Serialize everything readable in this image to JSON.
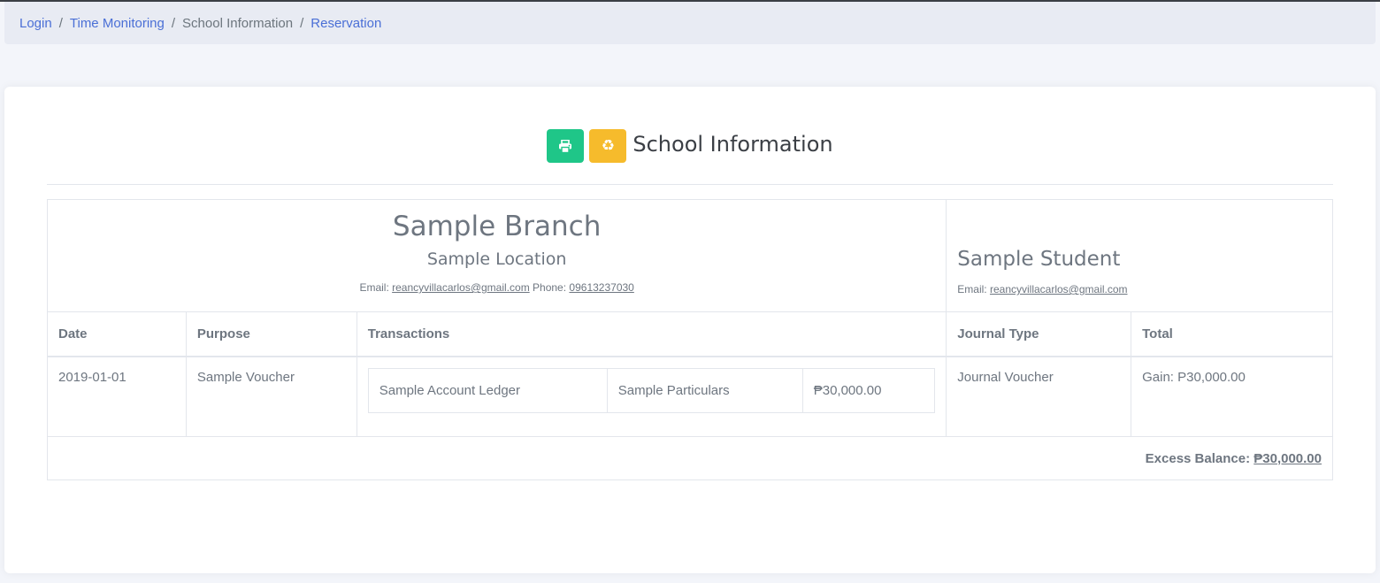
{
  "breadcrumb": {
    "items": [
      {
        "label": "Login",
        "link": true
      },
      {
        "label": "Time Monitoring",
        "link": true
      },
      {
        "label": "School Information",
        "link": false
      },
      {
        "label": "Reservation",
        "link": true
      }
    ]
  },
  "card": {
    "title": "School Information",
    "print_icon": "print-icon",
    "reset_icon": "recycle-icon"
  },
  "branch": {
    "name": "Sample Branch",
    "location": "Sample Location",
    "email_label": "Email:",
    "email": "reancyvillacarlos@gmail.com",
    "phone_label": "Phone:",
    "phone": "09613237030"
  },
  "student": {
    "name": "Sample Student",
    "email_label": "Email:",
    "email": "reancyvillacarlos@gmail.com"
  },
  "table": {
    "headers": [
      "Date",
      "Purpose",
      "Transactions",
      "Journal Type",
      "Total"
    ],
    "rows": [
      {
        "date": "2019-01-01",
        "purpose": "Sample Voucher",
        "transactions": [
          {
            "ledger": "Sample Account Ledger",
            "particulars": "Sample Particulars",
            "amount": "₱30,000.00"
          }
        ],
        "journal_type": "Journal Voucher",
        "total": "Gain: P30,000.00"
      }
    ],
    "footer_label": "Excess Balance:",
    "footer_value": "₱30,000.00"
  },
  "colors": {
    "print_button": "#1fc688",
    "reset_button": "#f6bb2c",
    "link": "#4a6fd6"
  }
}
